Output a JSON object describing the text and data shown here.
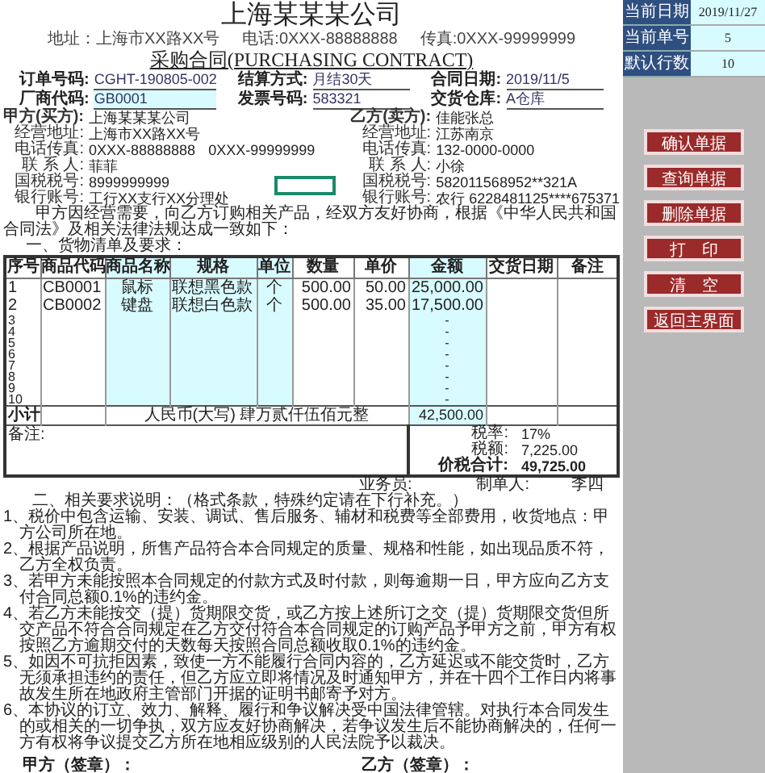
{
  "company": {
    "name": "上海某某某公司",
    "contacts": [
      "地址：上海市XX路XX号",
      "电话:0XXX-88888888",
      "传真:0XXX-99999999"
    ]
  },
  "title": "采购合同(PURCHASING CONTRACT)",
  "order_info": [
    {
      "label": "订单号码:",
      "value": "CGHT-190805-002",
      "highlighted": false
    },
    {
      "label": "结算方式:",
      "value": "月结30天",
      "highlighted": false
    },
    {
      "label": "合同日期:",
      "value": "2019/11/5",
      "highlighted": false
    },
    {
      "label": "厂商代码:",
      "value": "GB0001",
      "highlighted": true
    },
    {
      "label": "发票号码:",
      "value": "583321",
      "highlighted": false
    },
    {
      "label": "交货仓库:",
      "value": "A仓库",
      "highlighted": false
    }
  ],
  "buyer": [
    {
      "label": "甲方(买方):",
      "value": "上海某某某公司"
    },
    {
      "label": "经营地址:",
      "value": "上海市XX路XX号"
    },
    {
      "label": "电话传真:",
      "value": "0XXX-88888888",
      "value_2": "0XXX-99999999"
    },
    {
      "label": "联 系 人:",
      "value": "菲菲"
    },
    {
      "label": "国税税号:",
      "value": "8999999999"
    },
    {
      "label": "银行账号:",
      "value": "工行XX支行XX分理处"
    }
  ],
  "active_cell": true,
  "seller": [
    {
      "label": "乙方(卖方):",
      "value": "佳能张总"
    },
    {
      "label": "经营地址:",
      "value": "江苏南京"
    },
    {
      "label": "电话传真:",
      "value": "132-0000-0000"
    },
    {
      "label": "联 系 人:",
      "value": "小徐"
    },
    {
      "label": "国税税号:",
      "value": "582011568952**321A"
    },
    {
      "label": "银行账号:",
      "value": "农行 6228481125****675371"
    }
  ],
  "intro": "甲方因经营需要，向乙方订购相关产品，经双方友好协商，根据《中华人民共和国合同法》及相关法律法规达成一致如下：",
  "section_1": "一、货物清单及要求：",
  "table": {
    "columns": [
      {
        "label": "序号",
        "highlighted": false
      },
      {
        "label": "商品代码",
        "highlighted": false
      },
      {
        "label": "商品名称",
        "highlighted": true
      },
      {
        "label": "规格",
        "highlighted": true
      },
      {
        "label": "单位",
        "highlighted": true
      },
      {
        "label": "数量",
        "highlighted": false
      },
      {
        "label": "单价",
        "highlighted": false
      },
      {
        "label": "金额",
        "highlighted": true
      },
      {
        "label": "交货日期",
        "highlighted": false
      },
      {
        "label": "备注",
        "highlighted": false
      }
    ],
    "rows": [
      {
        "no": "1",
        "code": "CB0001",
        "name": "鼠标",
        "spec": "联想黑色款",
        "unit": "个",
        "qty": "500.00",
        "price": "50.00",
        "amount": "25,000.00"
      },
      {
        "no": "2",
        "code": "CB0002",
        "name": "键盘",
        "spec": "联想白色款",
        "unit": "个",
        "qty": "500.00",
        "price": "35.00",
        "amount": "17,500.00"
      },
      {
        "no": "3",
        "amount": "-"
      },
      {
        "no": "4",
        "amount": "-"
      },
      {
        "no": "5",
        "amount": "-"
      },
      {
        "no": "6",
        "amount": "-"
      },
      {
        "no": "7",
        "amount": "-"
      },
      {
        "no": "8",
        "amount": "-"
      },
      {
        "no": "9",
        "amount": "-"
      },
      {
        "no": "10",
        "amount": "-"
      }
    ],
    "subtotal": {
      "label": "小计",
      "amount_in_words": "人民币(大写) 肆万贰仟伍佰元整",
      "amount": "42,500.00"
    },
    "remarks_label": "备注:",
    "summary": [
      {
        "kind": "line",
        "label": "税率:",
        "value": "17%"
      },
      {
        "kind": "line",
        "label": "税额:",
        "value": "7,225.00"
      },
      {
        "kind": "total",
        "label": "价税合计:",
        "value": "49,725.00"
      }
    ]
  },
  "signoff": {
    "salesperson_label": "业务员:",
    "preparer_label": "制单人:",
    "preparer": "李四"
  },
  "section_2": "二、相关要求说明：（格式条款，特殊约定请在下行补充。）",
  "clauses": [
    "1、税价中包含运输、安装、调试、售后服务、辅材和税费等全部费用，收货地点：甲方公司所在地。",
    "2、根据产品说明，所售产品符合本合同规定的质量、规格和性能，如出现品质不符，乙方全权负责。",
    "3、若甲方未能按照本合同规定的付款方式及时付款，则每逾期一日，甲方应向乙方支付合同总额0.1%的违约金。",
    "4、若乙方未能按交（提）货期限交货，或乙方按上述所订之交（提）货期限交货但所交产品不符合合同规定在乙方交付符合本合同规定的订购产品予甲方之前，甲方有权按照乙方逾期交付的天数每天按照合同总额收取0.1%的违约金。",
    "5、如因不可抗拒因素，致使一方不能履行合同内容的，乙方延迟或不能交货时，乙方无须承担违约的责任，但乙方应立即将情况及时通知甲方，并在十四个工作日内将事故发生所在地政府主管部门开据的证明书邮寄予对方。",
    "6、本协议的订立、效力、解释、履行和争议解决受中国法律管辖。对执行本合同发生的或相关的一切争执，双方应友好协商解决，若争议发生后不能协商解决的，任何一方有权将争议提交乙方所在地相应级别的人民法院予以裁决。"
  ],
  "signatures": [
    "甲方（签章）：",
    "乙方（签章）："
  ],
  "side_panel": {
    "info": [
      {
        "label": "当前日期",
        "value": "2019/11/27"
      },
      {
        "label": "当前单号",
        "value": "5"
      },
      {
        "label": "默认行数",
        "value": "10"
      }
    ],
    "buttons": [
      "确认单据",
      "查询单据",
      "删除单据",
      "打　印",
      "清　空",
      "返回主界面"
    ]
  }
}
